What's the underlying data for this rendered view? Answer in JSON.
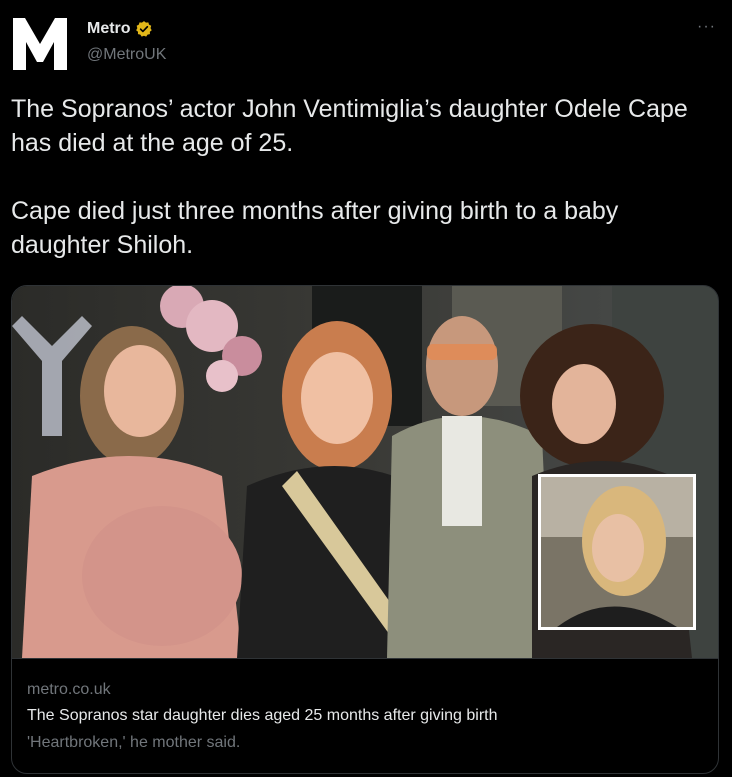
{
  "account": {
    "display_name": "Metro",
    "handle": "@MetroUK",
    "avatar_icon": "metro-m-logo",
    "logo_letter": "M",
    "verified_icon": "verified-badge-icon",
    "verified_color": "#e2b719"
  },
  "menu": {
    "more_label": "···"
  },
  "tweet": {
    "text": "The Sopranos’ actor John Ventimiglia’s daughter Odele Cape has died at the age of 25.\n\nCape died just three months after giving birth to a baby daughter Shiloh."
  },
  "link_card": {
    "domain": "metro.co.uk",
    "title": "The Sopranos star daughter dies aged 25 months after giving birth",
    "description": "'Heartbroken,' he mother said."
  },
  "colors": {
    "background": "#000000",
    "text_primary": "#e7e9ea",
    "text_secondary": "#71767b",
    "border": "#2f3336"
  }
}
